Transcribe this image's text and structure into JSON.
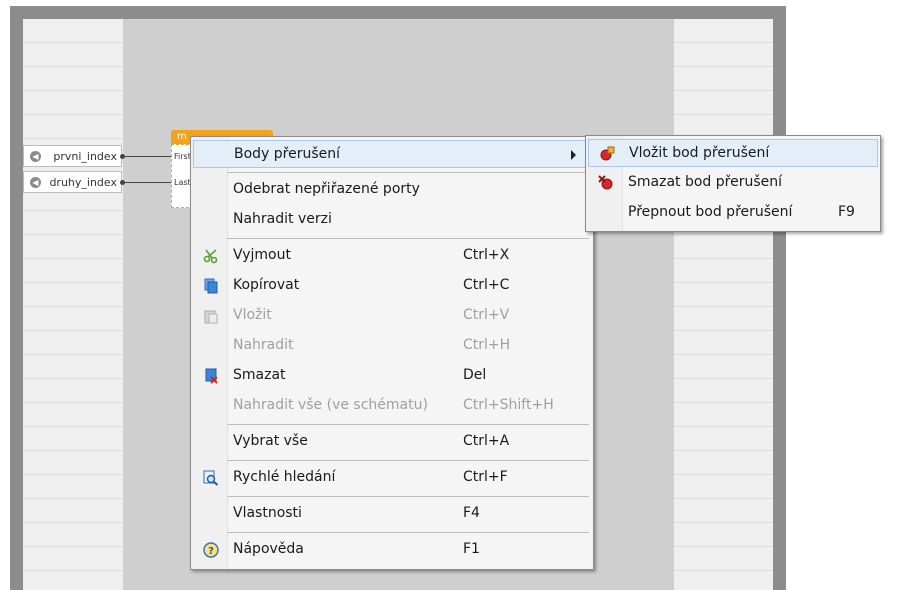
{
  "ports": [
    {
      "label": "prvni_index"
    },
    {
      "label": "druhy_index"
    }
  ],
  "block": {
    "title": "m",
    "ports": [
      "First",
      "Last"
    ]
  },
  "context_menu": {
    "items": [
      {
        "label": "Body přerušení",
        "shortcut": "",
        "has_submenu": true,
        "icon": ""
      },
      {
        "label": "Odebrat nepřiřazené porty",
        "shortcut": ""
      },
      {
        "label": "Nahradit verzi",
        "shortcut": ""
      },
      {
        "label": "Vyjmout",
        "shortcut": "Ctrl+X",
        "icon": "scissors-icon"
      },
      {
        "label": "Kopírovat",
        "shortcut": "Ctrl+C",
        "icon": "copy-icon"
      },
      {
        "label": "Vložit",
        "shortcut": "Ctrl+V",
        "icon": "paste-icon",
        "disabled": true
      },
      {
        "label": "Nahradit",
        "shortcut": "Ctrl+H",
        "disabled": true
      },
      {
        "label": "Smazat",
        "shortcut": "Del",
        "icon": "delete-icon"
      },
      {
        "label": "Nahradit vše (ve schématu)",
        "shortcut": "Ctrl+Shift+H",
        "disabled": true
      },
      {
        "label": "Vybrat vše",
        "shortcut": "Ctrl+A"
      },
      {
        "label": "Rychlé hledání",
        "shortcut": "Ctrl+F",
        "icon": "search-icon"
      },
      {
        "label": "Vlastnosti",
        "shortcut": "F4"
      },
      {
        "label": "Nápověda",
        "shortcut": "F1",
        "icon": "help-icon"
      }
    ]
  },
  "submenu": {
    "items": [
      {
        "label": "Vložit bod přerušení",
        "shortcut": "",
        "icon": "insert-breakpoint-icon"
      },
      {
        "label": "Smazat bod přerušení",
        "shortcut": "",
        "icon": "delete-breakpoint-icon"
      },
      {
        "label": "Přepnout bod přerušení",
        "shortcut": "F9"
      }
    ]
  },
  "colors": {
    "accent": "#f5a21a",
    "highlight": "#e4eef8",
    "menu_bg": "#f5f5f5"
  }
}
